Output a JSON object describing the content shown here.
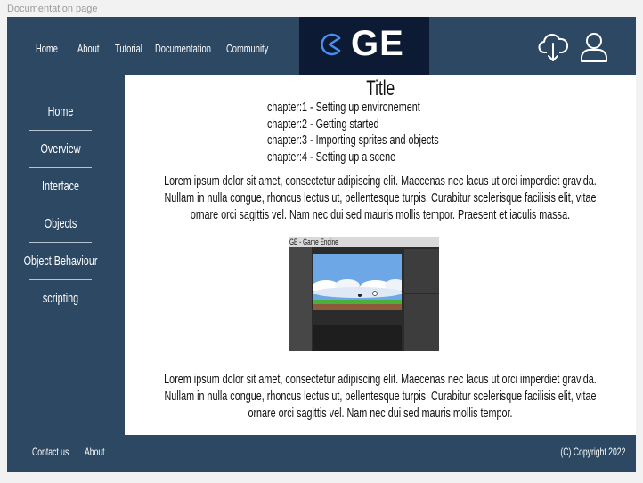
{
  "frame_label": "Documentation page",
  "header": {
    "nav": [
      "Home",
      "About",
      "Tutorial",
      "Documentation",
      "Community"
    ],
    "logo_text": "GE",
    "icons": [
      "cloud-download-icon",
      "user-icon"
    ]
  },
  "sidebar": {
    "items": [
      "Home",
      "Overview",
      "Interface",
      "Objects",
      "Object Behaviour",
      "scripting"
    ]
  },
  "content": {
    "title": "Title",
    "chapters": [
      "chapter:1 - Setting up environement",
      "chapter:2 - Getting started",
      "chapter:3 - Importing sprites and objects",
      "chapter:4 - Setting up a scene"
    ],
    "paragraph1": "Lorem ipsum dolor sit amet, consectetur adipiscing elit. Maecenas nec lacus ut orci imperdiet gravida. Nullam in nulla congue, rhoncus lectus ut, pellentesque turpis. Curabitur scelerisque facilisis elit, vitae ornare orci sagittis vel. Nam nec dui sed mauris mollis tempor. Praesent et iaculis massa.",
    "screenshot_title": "GE - Game Engine",
    "paragraph2": "Lorem ipsum dolor sit amet, consectetur adipiscing elit. Maecenas nec lacus ut orci imperdiet gravida. Nullam in nulla congue, rhoncus lectus ut, pellentesque turpis. Curabitur scelerisque facilisis elit, vitae ornare orci sagittis vel. Nam nec dui sed mauris mollis tempor."
  },
  "footer": {
    "links": [
      "Contact us",
      "About"
    ],
    "copyright": "(C) Copyright 2022"
  },
  "colors": {
    "primary": "#2c4862",
    "logo_bg": "#0c1a33",
    "content_bg": "#ffffff"
  }
}
